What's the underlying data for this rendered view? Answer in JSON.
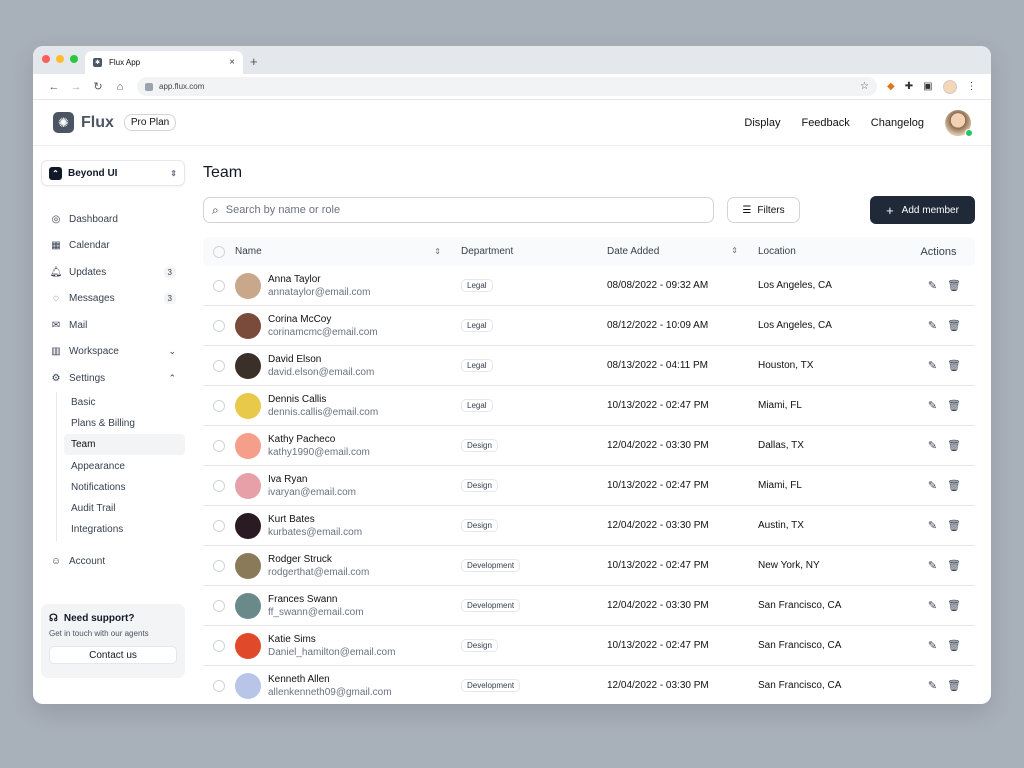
{
  "browser": {
    "tab_title": "Flux App",
    "new_tab": "+",
    "tab_close": "×",
    "url": "app.flux.com"
  },
  "header": {
    "logo_text": "Flux",
    "plan": "Pro Plan",
    "nav": [
      "Display",
      "Feedback",
      "Changelog"
    ]
  },
  "sidebar": {
    "workspace": "Beyond UI",
    "items": [
      {
        "label": "Dashboard",
        "icon": "dashboard-icon",
        "badge": ""
      },
      {
        "label": "Calendar",
        "icon": "calendar-icon",
        "badge": ""
      },
      {
        "label": "Updates",
        "icon": "bell-icon",
        "badge": "3"
      },
      {
        "label": "Messages",
        "icon": "message-icon",
        "badge": "3"
      },
      {
        "label": "Mail",
        "icon": "mail-icon",
        "badge": ""
      },
      {
        "label": "Workspace",
        "icon": "workspace-icon",
        "badge": ""
      },
      {
        "label": "Settings",
        "icon": "settings-icon",
        "badge": ""
      }
    ],
    "settings_sub": [
      "Basic",
      "Plans & Billing",
      "Team",
      "Appearance",
      "Notifications",
      "Audit Trail",
      "Integrations"
    ],
    "account": "Account",
    "support": {
      "title": "Need support?",
      "text": "Get in touch with our agents",
      "button": "Contact us"
    }
  },
  "main": {
    "title": "Team",
    "search_placeholder": "Search by name or role",
    "filters": "Filters",
    "add_member": "Add member",
    "columns": [
      "Name",
      "Department",
      "Date Added",
      "Location",
      "Actions"
    ],
    "rows": [
      {
        "name": "Anna Taylor",
        "email": "annataylor@email.com",
        "dept": "Legal",
        "date": "08/08/2022 - 09:32 AM",
        "location": "Los Angeles, CA",
        "color": "#c9a78a"
      },
      {
        "name": "Corina McCoy",
        "email": "corinamcmc@email.com",
        "dept": "Legal",
        "date": "08/12/2022 - 10:09 AM",
        "location": "Los Angeles, CA",
        "color": "#7a4a3a"
      },
      {
        "name": "David Elson",
        "email": "david.elson@email.com",
        "dept": "Legal",
        "date": "08/13/2022 - 04:11 PM",
        "location": "Houston, TX",
        "color": "#3b2f2a"
      },
      {
        "name": "Dennis Callis",
        "email": "dennis.callis@email.com",
        "dept": "Legal",
        "date": "10/13/2022 - 02:47 PM",
        "location": "Miami, FL",
        "color": "#e8c94a"
      },
      {
        "name": "Kathy Pacheco",
        "email": "kathy1990@email.com",
        "dept": "Design",
        "date": "12/04/2022 - 03:30  PM",
        "location": "Dallas, TX",
        "color": "#f59e8a"
      },
      {
        "name": "Iva Ryan",
        "email": "ivaryan@email.com",
        "dept": "Design",
        "date": "10/13/2022 - 02:47 PM",
        "location": "Miami, FL",
        "color": "#e8a0a8"
      },
      {
        "name": "Kurt Bates",
        "email": "kurbates@email.com",
        "dept": "Design",
        "date": "12/04/2022 - 03:30  PM",
        "location": "Austin, TX",
        "color": "#2a1a22"
      },
      {
        "name": "Rodger Struck",
        "email": "rodgerthat@email.com",
        "dept": "Development",
        "date": "10/13/2022 - 02:47 PM",
        "location": "New York, NY",
        "color": "#8a7a5a"
      },
      {
        "name": "Frances Swann",
        "email": "ff_swann@email.com",
        "dept": "Development",
        "date": "12/04/2022 - 03:30  PM",
        "location": "San Francisco, CA",
        "color": "#6a8a8a"
      },
      {
        "name": "Katie Sims",
        "email": "Daniel_hamilton@email.com",
        "dept": "Design",
        "date": "10/13/2022 - 02:47 PM",
        "location": "San Francisco, CA",
        "color": "#e04a2a"
      },
      {
        "name": "Kenneth Allen",
        "email": "allenkenneth09@gmail.com",
        "dept": "Development",
        "date": "12/04/2022 - 03:30  PM",
        "location": "San Francisco, CA",
        "color": "#b8c4e8"
      }
    ]
  }
}
